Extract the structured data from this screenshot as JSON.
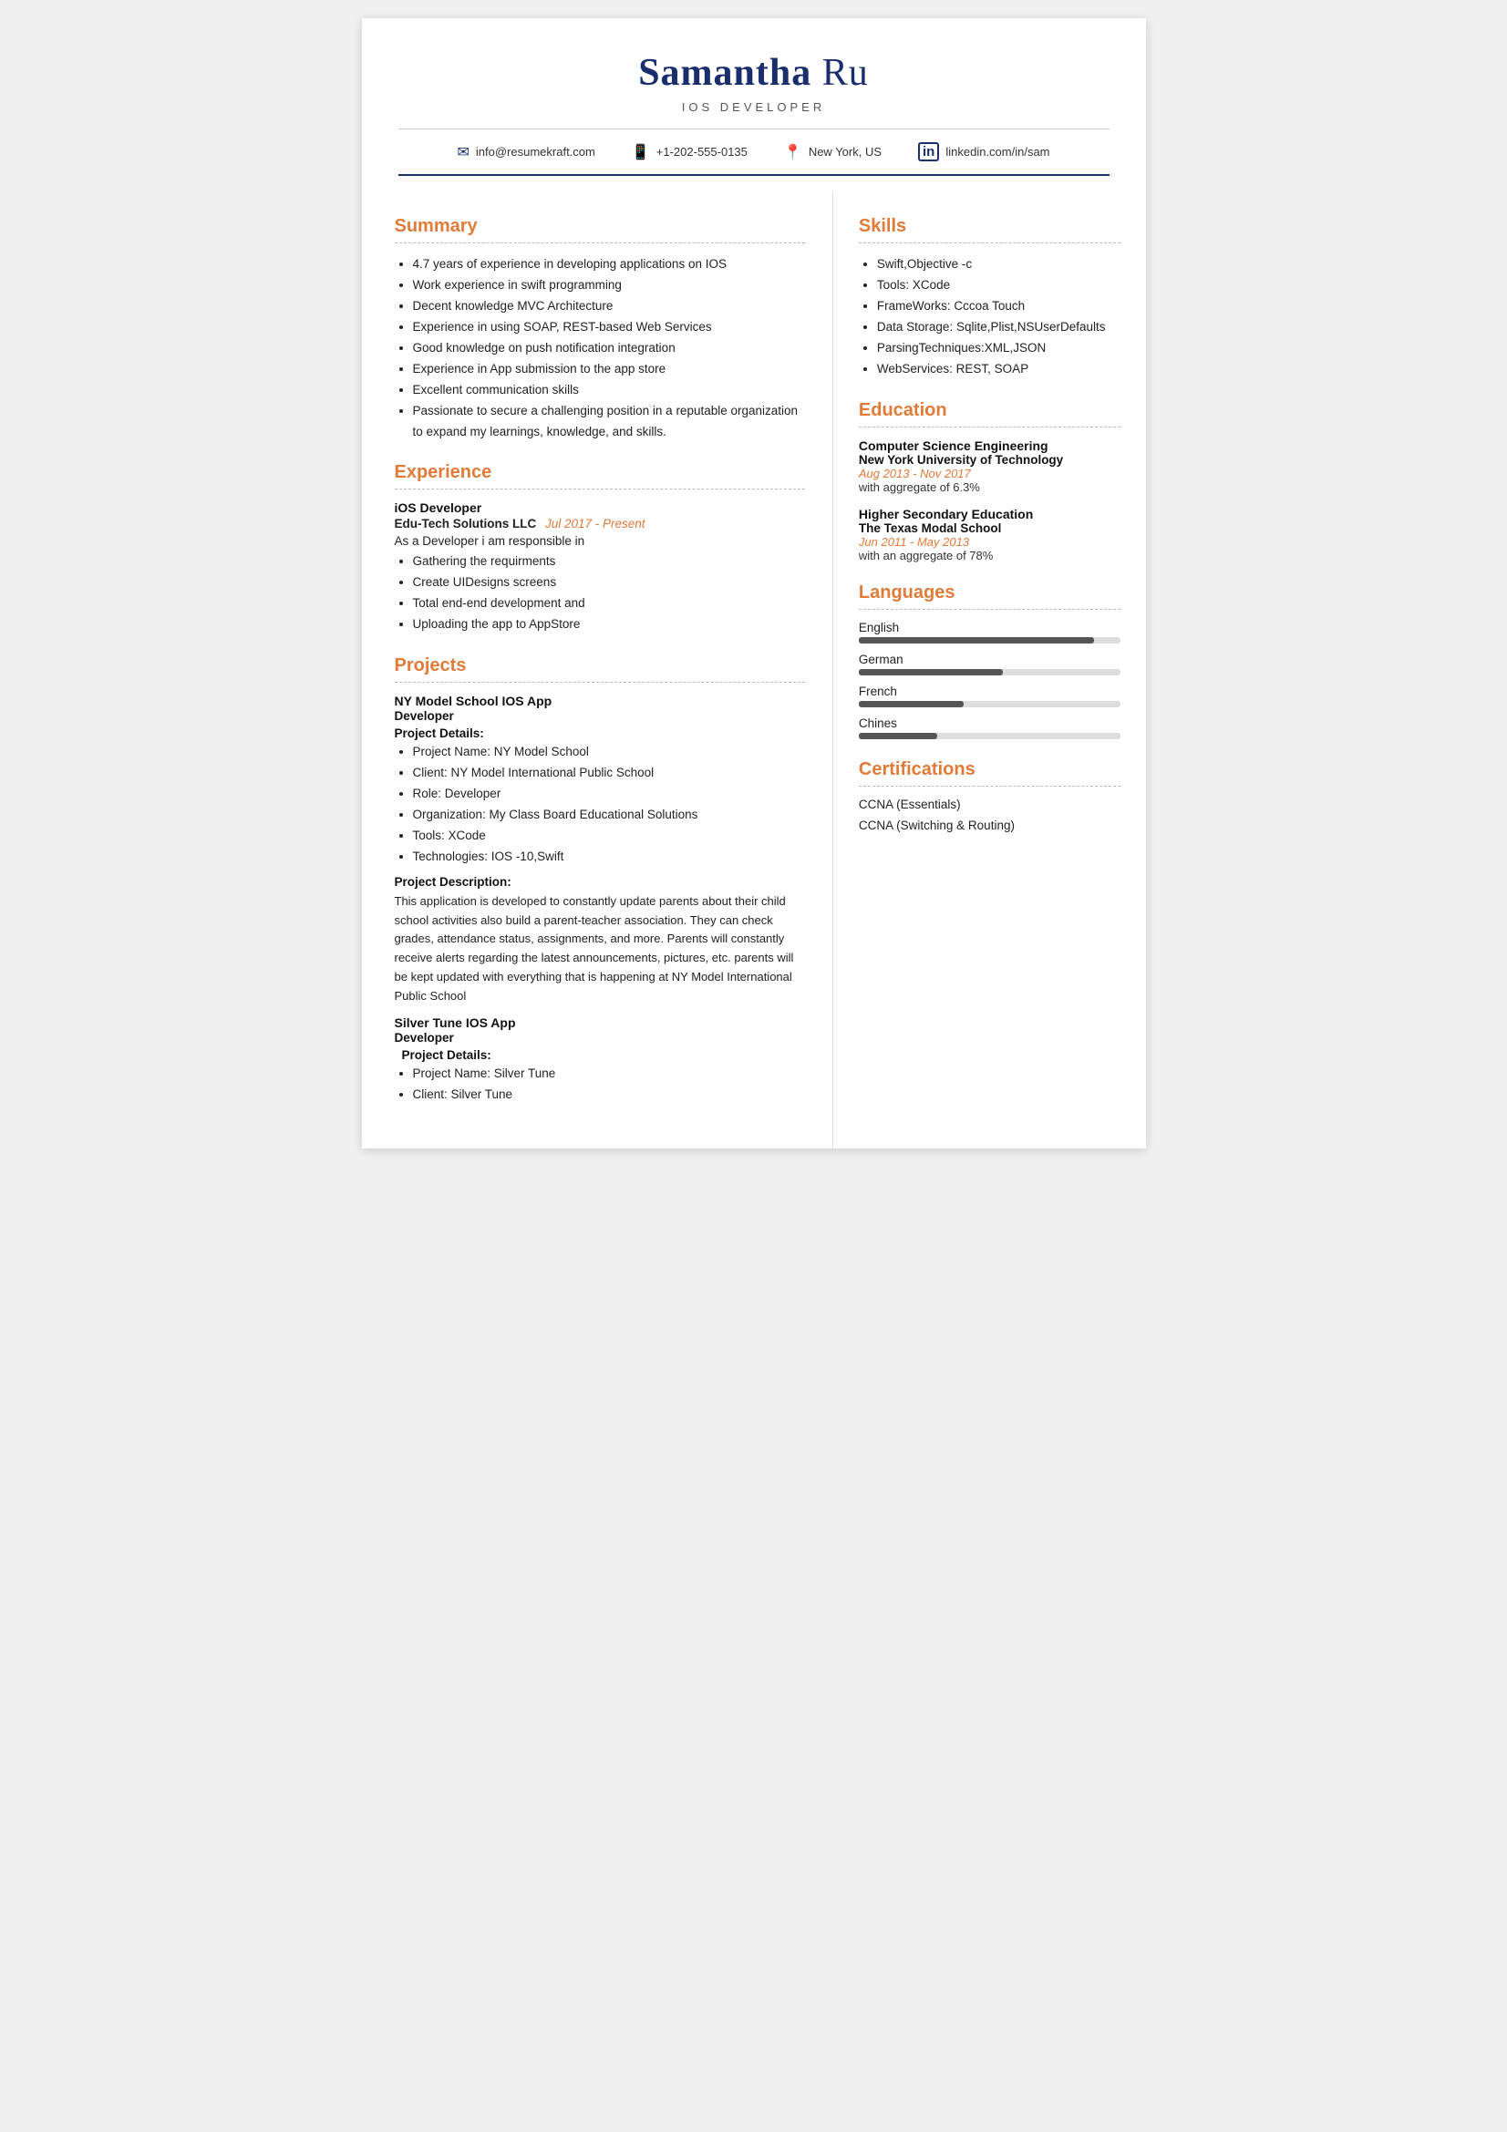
{
  "header": {
    "first_name": "Samantha",
    "last_name": "Ru",
    "title": "IOS DEVELOPER",
    "contact": {
      "email": "info@resumekraft.com",
      "phone": "+1-202-555-0135",
      "location": "New York, US",
      "linkedin": "linkedin.com/in/sam"
    }
  },
  "summary": {
    "section_title": "Summary",
    "items": [
      "4.7 years of experience in developing applications on IOS",
      "Work experience in swift programming",
      "Decent knowledge MVC Architecture",
      "Experience in using SOAP, REST-based Web Services",
      "Good knowledge on push notification integration",
      "Experience in App submission to the app store",
      "Excellent communication skills",
      "Passionate to secure a challenging position in a reputable organization to expand my learnings, knowledge, and skills."
    ]
  },
  "experience": {
    "section_title": "Experience",
    "entries": [
      {
        "job_title": "iOS Developer",
        "company": "Edu-Tech Solutions LLC",
        "date": "Jul 2017 - Present",
        "description": "As a Developer i am responsible in",
        "responsibilities": [
          "Gathering the requirments",
          "Create UIDesigns  screens",
          "Total end-end  development and",
          "Uploading the app to AppStore"
        ]
      }
    ]
  },
  "projects": {
    "section_title": "Projects",
    "entries": [
      {
        "name": "NY Model School IOS App",
        "role": "Developer",
        "details_label": "Project Details:",
        "details": [
          "Project Name: NY Model School",
          "Client: NY Model International Public School",
          "Role: Developer",
          "Organization: My Class Board Educational Solutions",
          "Tools: XCode",
          "Technologies: IOS -10,Swift"
        ],
        "desc_label": "Project Description:",
        "description": "This application is developed to constantly update parents about their child school activities also build a parent-teacher association. They can check grades, attendance status, assignments, and more. Parents will constantly receive alerts regarding the latest announcements, pictures, etc. parents will be kept updated with everything that is happening at NY Model International Public School"
      },
      {
        "name": "Silver Tune IOS App",
        "role": "Developer",
        "details_label": "Project Details:",
        "details": [
          "Project Name: Silver Tune",
          "Client: Silver Tune"
        ],
        "desc_label": "",
        "description": ""
      }
    ]
  },
  "skills": {
    "section_title": "Skills",
    "items": [
      "Swift,Objective -c",
      "Tools: XCode",
      "FrameWorks: Cccoa Touch",
      "Data Storage: Sqlite,Plist,NSUserDefaults",
      "ParsingTechniques:XML,JSON",
      "WebServices: REST, SOAP"
    ]
  },
  "education": {
    "section_title": "Education",
    "entries": [
      {
        "degree": "Computer Science Engineering",
        "school": "New York University of Technology",
        "date": "Aug 2013 - Nov 2017",
        "aggregate": "with aggregate of 6.3%"
      },
      {
        "degree": "Higher Secondary Education",
        "school": "The Texas Modal School",
        "date": "Jun 2011 - May 2013",
        "aggregate": "with an aggregate of 78%"
      }
    ]
  },
  "languages": {
    "section_title": "Languages",
    "entries": [
      {
        "name": "English",
        "percent": 90
      },
      {
        "name": "German",
        "percent": 55
      },
      {
        "name": "French",
        "percent": 40
      },
      {
        "name": "Chines",
        "percent": 30
      }
    ]
  },
  "certifications": {
    "section_title": "Certifications",
    "items": [
      "CCNA (Essentials)",
      "CCNA (Switching & Routing)"
    ]
  },
  "icons": {
    "email": "✉",
    "phone": "📱",
    "location": "📍",
    "linkedin": "in"
  }
}
